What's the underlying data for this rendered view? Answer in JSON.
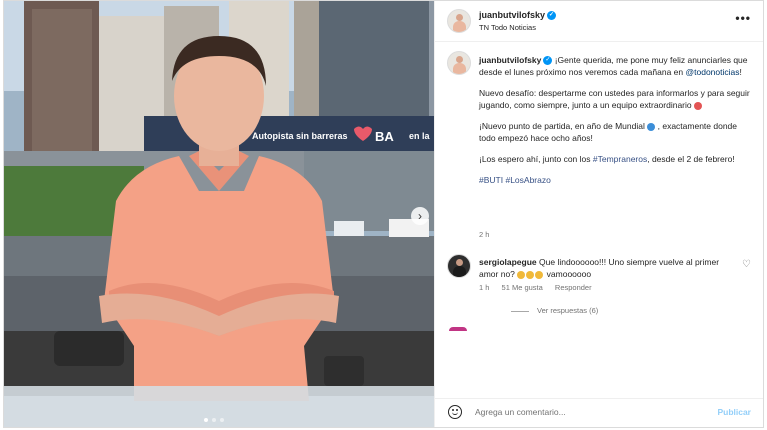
{
  "post": {
    "username": "juanbutvilofsky",
    "subtitle": "TN Todo Noticias",
    "more_label": "•••"
  },
  "photo": {
    "billboard_text": "Autopista sin barreras",
    "billboard_brand": "BA",
    "billboard_tail": "en la",
    "next_label": "›"
  },
  "caption": {
    "username": "juanbutvilofsky",
    "p1_text": "¡Gente querida, me pone muy feliz anunciarles que desde el lunes próximo nos veremos cada mañana en",
    "p1_mention": "@todonoticias",
    "p1_end": "!",
    "p2_text": "Nuevo desafío: despertarme con ustedes para informarlos y para seguir jugando, como siempre, junto a un equipo extraordinario",
    "p3_text": "¡Nuevo punto de partida, en año de Mundial",
    "p3_end": ", exactamente donde todo empezó hace ocho años!",
    "p4_start": "¡Los espero ahí, junto con los",
    "p4_tag": "#Tempraneros",
    "p4_end": ", desde el 2 de febrero!",
    "tag1": "#BUTI",
    "tag2": "#LosAbrazo",
    "time": "2 h"
  },
  "comment": {
    "username": "sergiolapegue",
    "text": "Que lindoooooo!!! Uno siempre vuelve al primer amor no?",
    "text_end": "vamoooooo",
    "time": "1 h",
    "likes": "51 Me gusta",
    "reply": "Responder",
    "view_replies": "Ver respuestas (6)"
  },
  "composer": {
    "placeholder": "Agrega un comentario...",
    "publish": "Publicar"
  },
  "colors": {
    "accent_blue": "#0095f6",
    "link_dark": "#00376b",
    "hashtag": "#385185",
    "publish_disabled": "#93cff9"
  },
  "icons": [
    "verified-badge-icon",
    "more-options-icon",
    "heart-icon",
    "emoji-smile-icon",
    "carousel-next-icon"
  ]
}
